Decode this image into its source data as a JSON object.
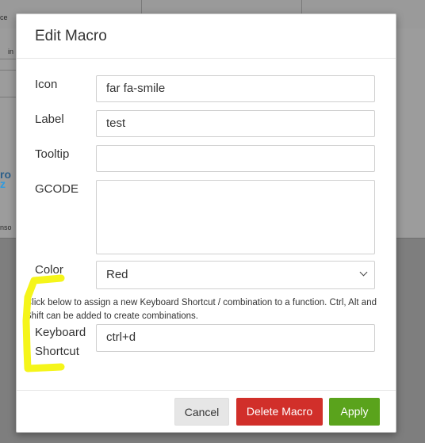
{
  "background": {
    "fragments": [
      "ce",
      "in",
      "ro",
      "z",
      "nso"
    ]
  },
  "modal": {
    "title": "Edit Macro",
    "fields": {
      "icon": {
        "label": "Icon",
        "value": "far fa-smile"
      },
      "label": {
        "label": "Label",
        "value": "test"
      },
      "tooltip": {
        "label": "Tooltip",
        "value": ""
      },
      "gcode": {
        "label": "GCODE",
        "value": ""
      },
      "color": {
        "label": "Color",
        "value": "Red"
      },
      "shortcut": {
        "label_line1": "Keyboard",
        "label_line2": "Shortcut",
        "value": "ctrl+d"
      }
    },
    "help_text": "Click below to assign a new Keyboard Shortcut / combination to a function. Ctrl, Alt and Shift can be added to create combinations.",
    "buttons": {
      "cancel": "Cancel",
      "delete": "Delete Macro",
      "apply": "Apply"
    }
  },
  "colors": {
    "delete": "#d12f2a",
    "apply": "#5aa31c",
    "highlight": "#f5f51a"
  }
}
